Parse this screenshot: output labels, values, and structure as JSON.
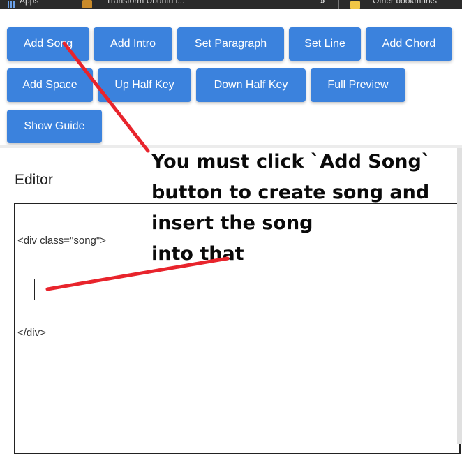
{
  "bookmarks_bar": {
    "apps_label": "Apps",
    "ubuntu_label": "Transform Ubuntu i...",
    "more_label": "»",
    "other_label": "Other bookmarks"
  },
  "toolbar": {
    "buttons": [
      {
        "label": "Add Song"
      },
      {
        "label": "Add Intro"
      },
      {
        "label": "Set Paragraph"
      },
      {
        "label": "Set Line"
      },
      {
        "label": "Add Chord"
      },
      {
        "label": "Add Space"
      },
      {
        "label": "Up Half Key"
      },
      {
        "label": "Down Half Key"
      },
      {
        "label": "Full Preview"
      },
      {
        "label": "Show Guide"
      }
    ]
  },
  "editor": {
    "heading": "Editor",
    "lines": [
      "<div class=\"song\">",
      "</div>"
    ]
  },
  "annotation": {
    "lines": [
      "You must click `Add Song`",
      "button to create song and",
      "insert the song",
      "into that"
    ],
    "arrow_color": "#e8242c"
  },
  "colors": {
    "button_bg": "#3b82dd",
    "button_text": "#ffffff"
  }
}
